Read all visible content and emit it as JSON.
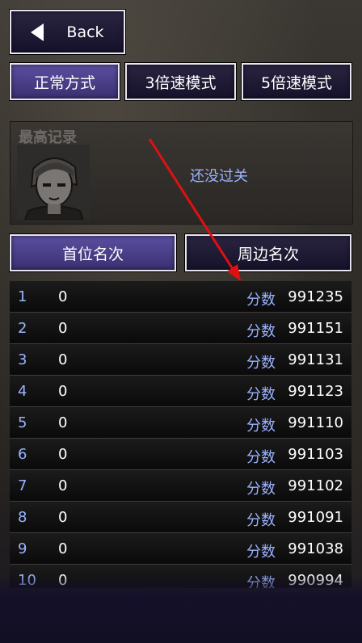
{
  "back_label": "Back",
  "modes": [
    "正常方式",
    "3倍速模式",
    "5倍速模式"
  ],
  "record": {
    "label": "最高记录",
    "status": "还没过关"
  },
  "tabs": [
    "首位名次",
    "周边名次"
  ],
  "score_label": "分数",
  "rankings": [
    {
      "rank": "1",
      "name": "0",
      "score": "991235"
    },
    {
      "rank": "2",
      "name": "0",
      "score": "991151"
    },
    {
      "rank": "3",
      "name": "0",
      "score": "991131"
    },
    {
      "rank": "4",
      "name": "0",
      "score": "991123"
    },
    {
      "rank": "5",
      "name": "0",
      "score": "991110"
    },
    {
      "rank": "6",
      "name": "0",
      "score": "991103"
    },
    {
      "rank": "7",
      "name": "0",
      "score": "991102"
    },
    {
      "rank": "8",
      "name": "0",
      "score": "991091"
    },
    {
      "rank": "9",
      "name": "0",
      "score": "991038"
    },
    {
      "rank": "10",
      "name": "0",
      "score": "990994"
    }
  ],
  "colors": {
    "accent": "#9ab3ff",
    "active_button": "#5b4fa0",
    "arrow": "#e01010"
  }
}
